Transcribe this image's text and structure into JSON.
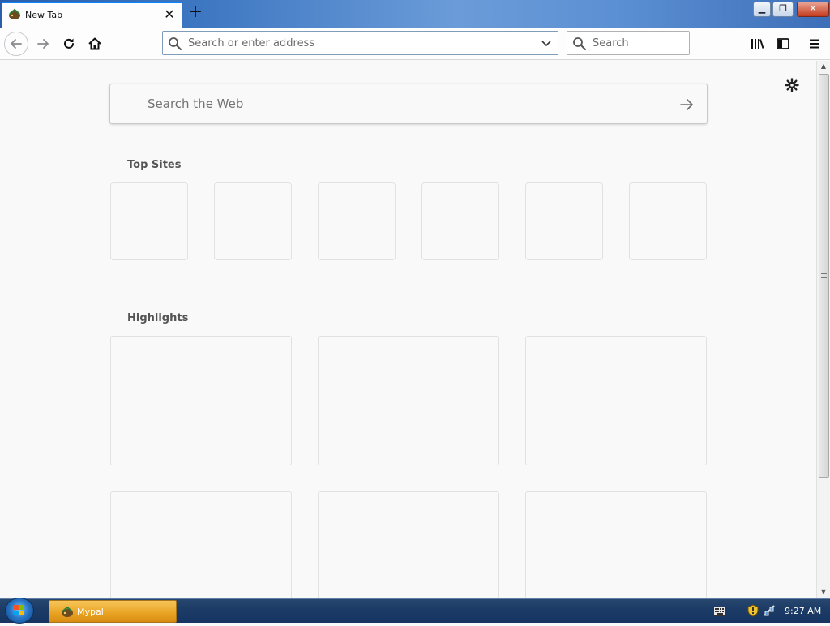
{
  "browser": {
    "tab": {
      "title": "New Tab"
    },
    "urlbar": {
      "placeholder": "Search or enter address"
    },
    "searchbar": {
      "placeholder": "Search"
    },
    "accent": "#0a84ff"
  },
  "newtab": {
    "web_search": {
      "placeholder": "Search the Web"
    },
    "top_sites": {
      "title": "Top Sites",
      "tile_count": 6
    },
    "highlights": {
      "title": "Highlights",
      "card_count": 6
    }
  },
  "icons": {
    "nav": [
      "back-arrow-icon",
      "forward-arrow-icon",
      "reload-icon",
      "home-icon"
    ],
    "toolbar": [
      "library-icon",
      "sidebar-icon",
      "hamburger-menu-icon"
    ],
    "content": [
      "gear-icon",
      "arrow-right-icon"
    ]
  },
  "taskbar": {
    "app_label": "Mypal",
    "clock": "9:27 AM"
  }
}
